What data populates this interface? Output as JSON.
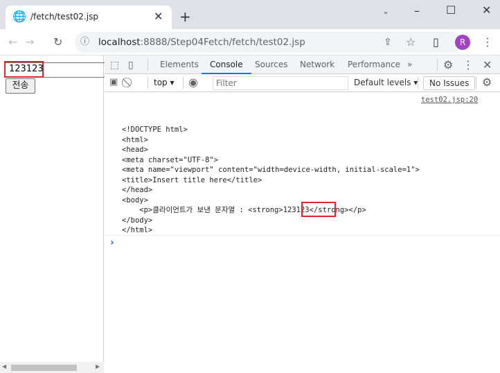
{
  "browser": {
    "tab_title": "/fetch/test02.jsp",
    "url_host": "localhost",
    "url_rest": ":8888/Step04Fetch/fetch/test02.jsp",
    "profile_initial": "R",
    "profile_color": "#a142c4"
  },
  "page": {
    "input_value": "123123",
    "submit_label": "전송"
  },
  "devtools": {
    "tabs": [
      "Elements",
      "Console",
      "Sources",
      "Network",
      "Performance"
    ],
    "active_tab": "Console",
    "context": "top",
    "filter_placeholder": "Filter",
    "levels": "Default levels",
    "issues": "No Issues",
    "source_link": "test02.jsp:20",
    "output_lines": [
      "<!DOCTYPE html>",
      "<html>",
      "<head>",
      "<meta charset=\"UTF-8\">",
      "<meta name=\"viewport\" content=\"width=device-width, initial-scale=1\">",
      "<title>Insert title here</title>",
      "</head>",
      "<body>",
      "    <p>클라이언트가 보낸 문자열 : <strong>123123</strong></p>",
      "</body>",
      "</html>"
    ],
    "prompt": "›"
  },
  "highlight_color": "#e3242b"
}
